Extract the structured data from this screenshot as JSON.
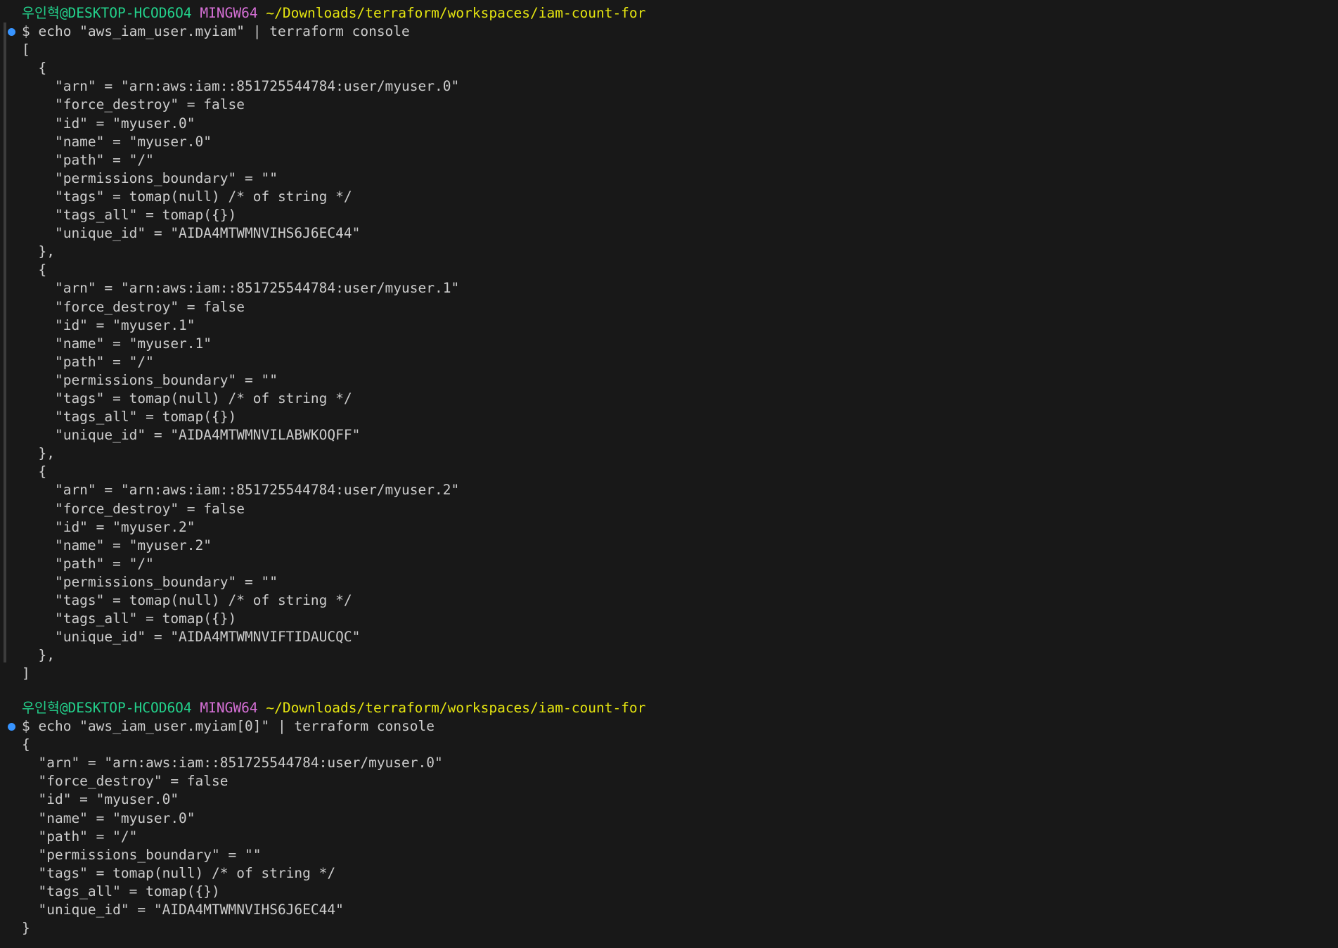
{
  "terminal": {
    "colors": {
      "background": "#181818",
      "text": "#cccccc",
      "user": "#23d18b",
      "system": "#d670d6",
      "path": "#e5e510",
      "command_marker": "#3794ff"
    },
    "blocks": [
      {
        "prompt": {
          "user": "우인혁@DESKTOP-HCOD6O4",
          "system": "MINGW64",
          "path": "~/Downloads/terraform/workspaces/iam-count-for"
        },
        "command": "$ echo \"aws_iam_user.myiam\" | terraform console",
        "output": [
          "[",
          "  {",
          "    \"arn\" = \"arn:aws:iam::851725544784:user/myuser.0\"",
          "    \"force_destroy\" = false",
          "    \"id\" = \"myuser.0\"",
          "    \"name\" = \"myuser.0\"",
          "    \"path\" = \"/\"",
          "    \"permissions_boundary\" = \"\"",
          "    \"tags\" = tomap(null) /* of string */",
          "    \"tags_all\" = tomap({})",
          "    \"unique_id\" = \"AIDA4MTWMNVIHS6J6EC44\"",
          "  },",
          "  {",
          "    \"arn\" = \"arn:aws:iam::851725544784:user/myuser.1\"",
          "    \"force_destroy\" = false",
          "    \"id\" = \"myuser.1\"",
          "    \"name\" = \"myuser.1\"",
          "    \"path\" = \"/\"",
          "    \"permissions_boundary\" = \"\"",
          "    \"tags\" = tomap(null) /* of string */",
          "    \"tags_all\" = tomap({})",
          "    \"unique_id\" = \"AIDA4MTWMNVILABWKOQFF\"",
          "  },",
          "  {",
          "    \"arn\" = \"arn:aws:iam::851725544784:user/myuser.2\"",
          "    \"force_destroy\" = false",
          "    \"id\" = \"myuser.2\"",
          "    \"name\" = \"myuser.2\"",
          "    \"path\" = \"/\"",
          "    \"permissions_boundary\" = \"\"",
          "    \"tags\" = tomap(null) /* of string */",
          "    \"tags_all\" = tomap({})",
          "    \"unique_id\" = \"AIDA4MTWMNVIFTIDAUCQC\"",
          "  },",
          "]"
        ]
      },
      {
        "prompt": {
          "user": "우인혁@DESKTOP-HCOD6O4",
          "system": "MINGW64",
          "path": "~/Downloads/terraform/workspaces/iam-count-for"
        },
        "command": "$ echo \"aws_iam_user.myiam[0]\" | terraform console",
        "output": [
          "{",
          "  \"arn\" = \"arn:aws:iam::851725544784:user/myuser.0\"",
          "  \"force_destroy\" = false",
          "  \"id\" = \"myuser.0\"",
          "  \"name\" = \"myuser.0\"",
          "  \"path\" = \"/\"",
          "  \"permissions_boundary\" = \"\"",
          "  \"tags\" = tomap(null) /* of string */",
          "  \"tags_all\" = tomap({})",
          "  \"unique_id\" = \"AIDA4MTWMNVIHS6J6EC44\"",
          "}"
        ]
      }
    ]
  }
}
